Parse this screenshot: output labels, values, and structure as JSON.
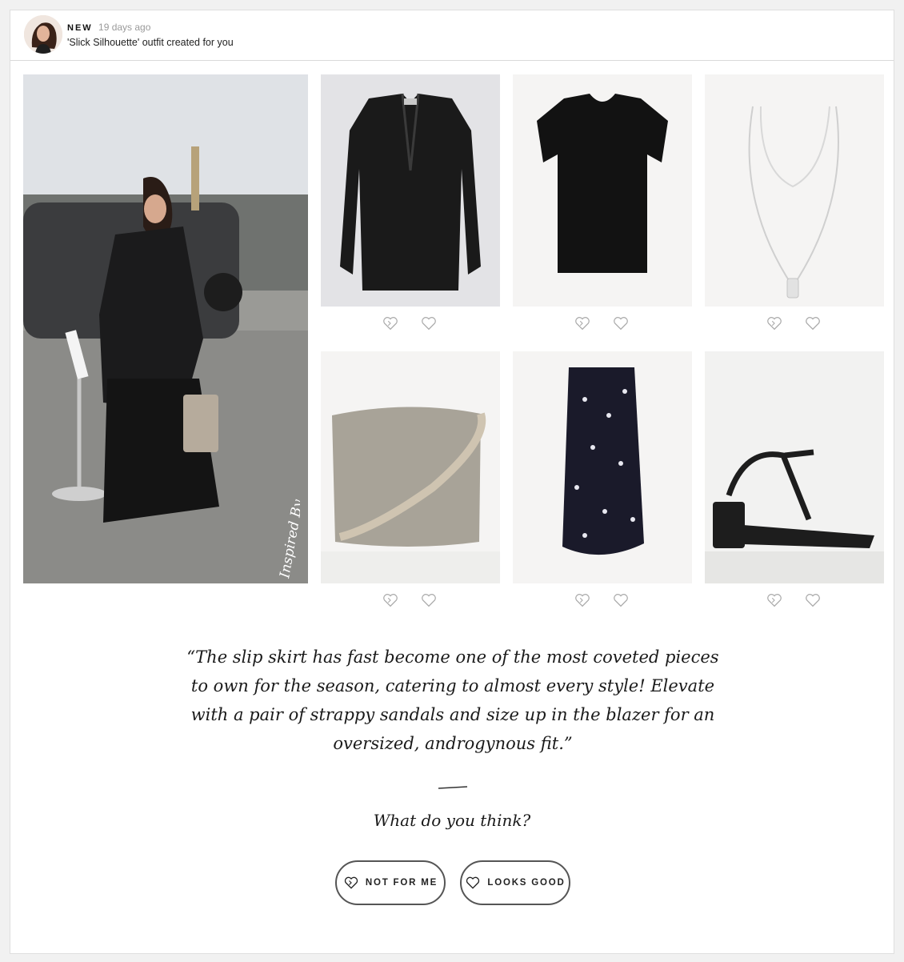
{
  "header": {
    "badge": "NEW",
    "time_ago": "19 days ago",
    "subtitle": "'Slick Silhouette' outfit created for you"
  },
  "inspiration": {
    "caption": "Inspired By"
  },
  "products": [
    {
      "name": "blazer",
      "icons": [
        "dislike-heart-icon",
        "heart-icon"
      ]
    },
    {
      "name": "t-shirt",
      "icons": [
        "dislike-heart-icon",
        "heart-icon"
      ]
    },
    {
      "name": "necklace",
      "icons": [
        "dislike-heart-icon",
        "heart-icon"
      ]
    },
    {
      "name": "bag",
      "icons": [
        "dislike-heart-icon",
        "heart-icon"
      ]
    },
    {
      "name": "skirt",
      "icons": [
        "dislike-heart-icon",
        "heart-icon"
      ]
    },
    {
      "name": "sandals",
      "icons": [
        "dislike-heart-icon",
        "heart-icon"
      ]
    }
  ],
  "quote": "“The slip skirt has fast become one of the most coveted pieces to own for the season, catering to almost every style! Elevate with a pair of strappy sandals and size up in the blazer for an oversized, androgynous fit.”",
  "question": "What do you think?",
  "buttons": {
    "not_for_me": "NOT FOR ME",
    "looks_good": "LOOKS GOOD"
  },
  "colors": {
    "text": "#222222",
    "border": "#555555",
    "muted": "#9a9a9a"
  }
}
